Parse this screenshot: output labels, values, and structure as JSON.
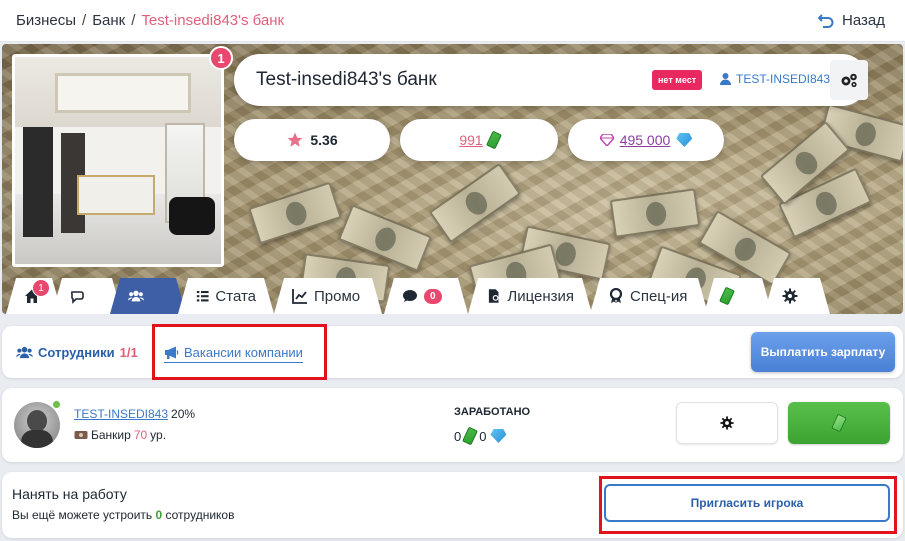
{
  "breadcrumb": {
    "items": [
      "Бизнесы",
      "Банк"
    ],
    "current": "Test-insedi843's банк",
    "separator": "/"
  },
  "back_label": "Назад",
  "business": {
    "photo_badge": "1",
    "title": "Test-insedi843's банк",
    "status_badge": "нет мест",
    "owner": "TEST-INSEDI843",
    "rating": "5.36",
    "money": "991",
    "gems": "495 000"
  },
  "tabs": [
    {
      "label": "",
      "icon": "home-icon",
      "badge": "1"
    },
    {
      "label": "",
      "icon": "chat-icon"
    },
    {
      "label": "",
      "icon": "users-icon",
      "active": true
    },
    {
      "label": "Стата",
      "icon": "list-icon"
    },
    {
      "label": "Промо",
      "icon": "chart-icon"
    },
    {
      "label": "",
      "icon": "comment-icon",
      "count": "0"
    },
    {
      "label": "Лицензия",
      "icon": "license-icon"
    },
    {
      "label": "Спец-ия",
      "icon": "award-icon"
    },
    {
      "label": "",
      "icon": "money-icon"
    },
    {
      "label": "",
      "icon": "gear-icon"
    }
  ],
  "subbar": {
    "employees_label": "Сотрудники",
    "employees_ratio": "1/1",
    "vacancies_label": "Вакансии компании",
    "pay_salary_label": "Выплатить зарплату"
  },
  "employee": {
    "name": "TEST-INSEDI843",
    "percent": "20%",
    "role": "Банкир",
    "level": "70",
    "level_suffix": "ур.",
    "earned_label": "ЗАРАБОТАНО",
    "earned_money": "0",
    "earned_gems": "0"
  },
  "hire": {
    "title": "Нанять на работу",
    "subtitle_prefix": "Вы ещё можете устроить",
    "subtitle_count": "0",
    "subtitle_suffix": "сотрудников",
    "invite_label": "Пригласить игрока"
  },
  "colors": {
    "accent": "#3e5fa6",
    "pink": "#e0607a",
    "link": "#3a78c8",
    "green": "#3ca332",
    "highlight": "#e0141c"
  }
}
